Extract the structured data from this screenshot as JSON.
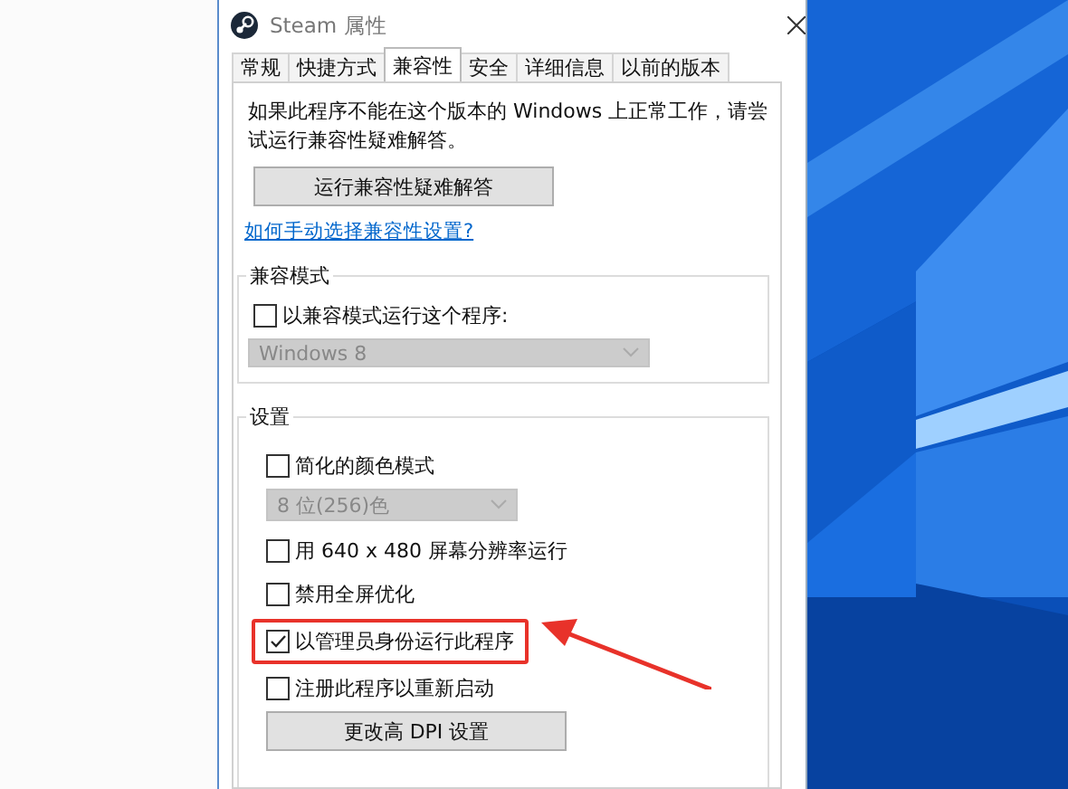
{
  "window": {
    "title": "Steam 属性"
  },
  "tabs": [
    {
      "label": "常规",
      "selected": false
    },
    {
      "label": "快捷方式",
      "selected": false
    },
    {
      "label": "兼容性",
      "selected": true
    },
    {
      "label": "安全",
      "selected": false
    },
    {
      "label": "详细信息",
      "selected": false
    },
    {
      "label": "以前的版本",
      "selected": false
    }
  ],
  "intro": "如果此程序不能在这个版本的 Windows 上正常工作，请尝试运行兼容性疑难解答。",
  "troubleshoot_button": "运行兼容性疑难解答",
  "help_link": "如何手动选择兼容性设置?",
  "compat_group": {
    "title": "兼容模式",
    "checkbox": {
      "label": "以兼容模式运行这个程序:",
      "checked": false
    },
    "dropdown": {
      "value": "Windows 8",
      "disabled": true
    }
  },
  "settings_group": {
    "title": "设置",
    "items": [
      {
        "kind": "checkbox",
        "label": "简化的颜色模式",
        "checked": false,
        "highlighted": false
      },
      {
        "kind": "dropdown",
        "value": "8 位(256)色",
        "disabled": true
      },
      {
        "kind": "checkbox",
        "label": "用 640 x 480 屏幕分辨率运行",
        "checked": false,
        "highlighted": false
      },
      {
        "kind": "checkbox",
        "label": "禁用全屏优化",
        "checked": false,
        "highlighted": false
      },
      {
        "kind": "checkbox",
        "label": "以管理员身份运行此程序",
        "checked": true,
        "highlighted": true
      },
      {
        "kind": "checkbox",
        "label": "注册此程序以重新启动",
        "checked": false,
        "highlighted": false
      },
      {
        "kind": "button",
        "label": "更改高 DPI 设置"
      }
    ]
  }
}
